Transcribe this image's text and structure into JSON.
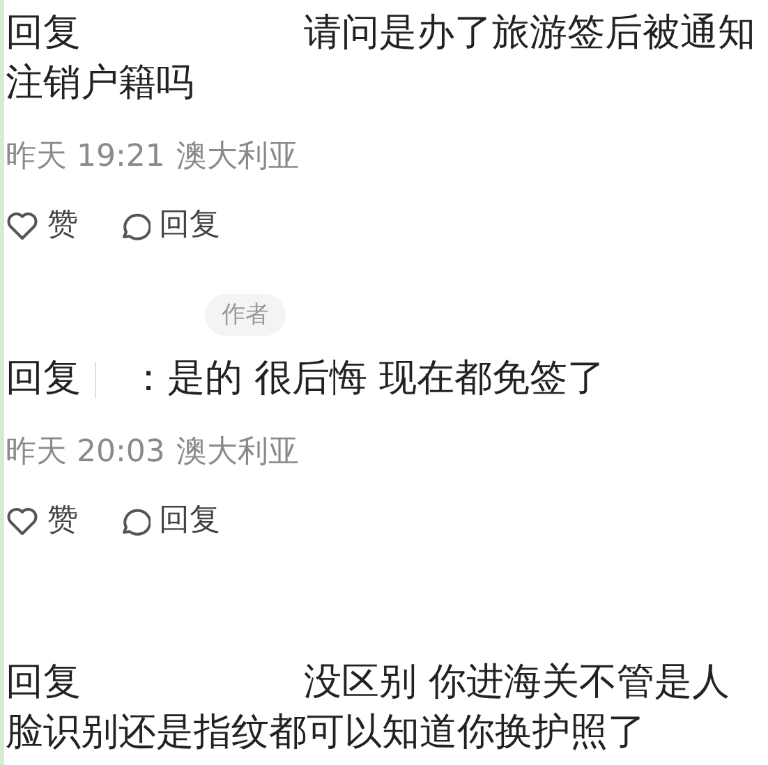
{
  "comments": [
    {
      "prefix": "回复",
      "text": "请问是办了旅游签后被通知注销户籍吗",
      "time": "昨天 19:21",
      "location": "澳大利亚",
      "actions": [
        {
          "kind": "like",
          "label": "赞"
        },
        {
          "kind": "reply",
          "label": "回复"
        }
      ]
    },
    {
      "author_badge": "作者",
      "prefix": "回复",
      "text": "：是的 很后悔 现在都免签了",
      "time": "昨天 20:03",
      "location": "澳大利亚",
      "actions": [
        {
          "kind": "like",
          "label": "赞"
        },
        {
          "kind": "reply",
          "label": "回复"
        }
      ]
    },
    {
      "prefix": "回复",
      "text": "没区别 你进海关不管是人脸识别还是指纹都可以知道你换护照了"
    }
  ]
}
